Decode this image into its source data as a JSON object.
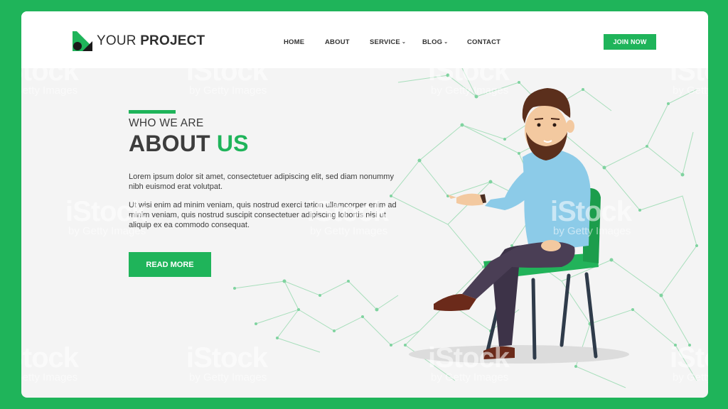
{
  "brand": {
    "name_light": "YOUR ",
    "name_bold": "PROJECT",
    "icon": "logo-mark-icon",
    "accent_color": "#1fb45a"
  },
  "nav": {
    "items": [
      {
        "label": "HOME",
        "dropdown": false
      },
      {
        "label": "ABOUT",
        "dropdown": false
      },
      {
        "label": "SERVICE",
        "dropdown": true
      },
      {
        "label": "BLOG",
        "dropdown": true
      },
      {
        "label": "CONTACT",
        "dropdown": false
      }
    ],
    "dropdown_icon": "chevron-down-icon",
    "cta_label": "JOIN NOW"
  },
  "hero": {
    "kicker": "WHO WE ARE",
    "title_dark": "ABOUT ",
    "title_accent": "US",
    "paragraph1": "Lorem ipsum dolor sit amet, consectetuer adipiscing elit, sed diam nonummy nibh euismod erat volutpat.",
    "paragraph2": "Ut wisi enim ad minim veniam, quis nostrud exerci tation ullamcorper enim ad minim veniam, quis nostrud suscipit consectetuer adipiscing lobortis nisi ut aliquip ex ea commodo consequat.",
    "button_label": "READ MORE"
  },
  "watermark": {
    "line1": "iStock",
    "line2": "by Getty Images"
  }
}
